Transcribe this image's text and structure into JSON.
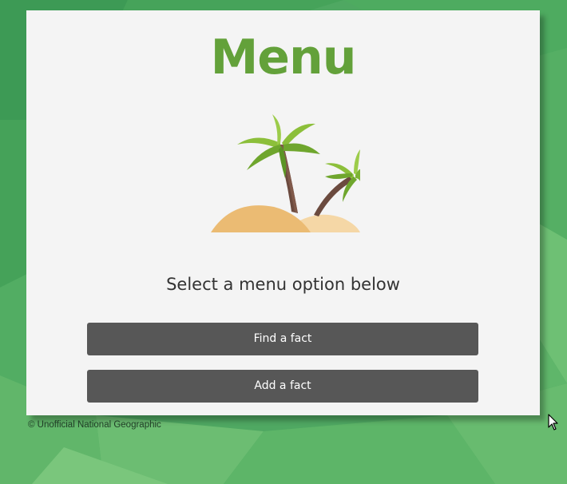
{
  "page": {
    "title": "Menu",
    "subtitle": "Select a menu option below"
  },
  "buttons": {
    "find_label": "Find a fact",
    "add_label": "Add a fact"
  },
  "footer": {
    "text": "© Unofficial National Geographic"
  },
  "illustration": {
    "icon": "palm-trees-island-icon"
  },
  "colors": {
    "background_green": "#4fa862",
    "title_green": "#63a13a",
    "card_background": "#f4f4f4",
    "button_background": "#575757",
    "button_text": "#ffffff"
  }
}
